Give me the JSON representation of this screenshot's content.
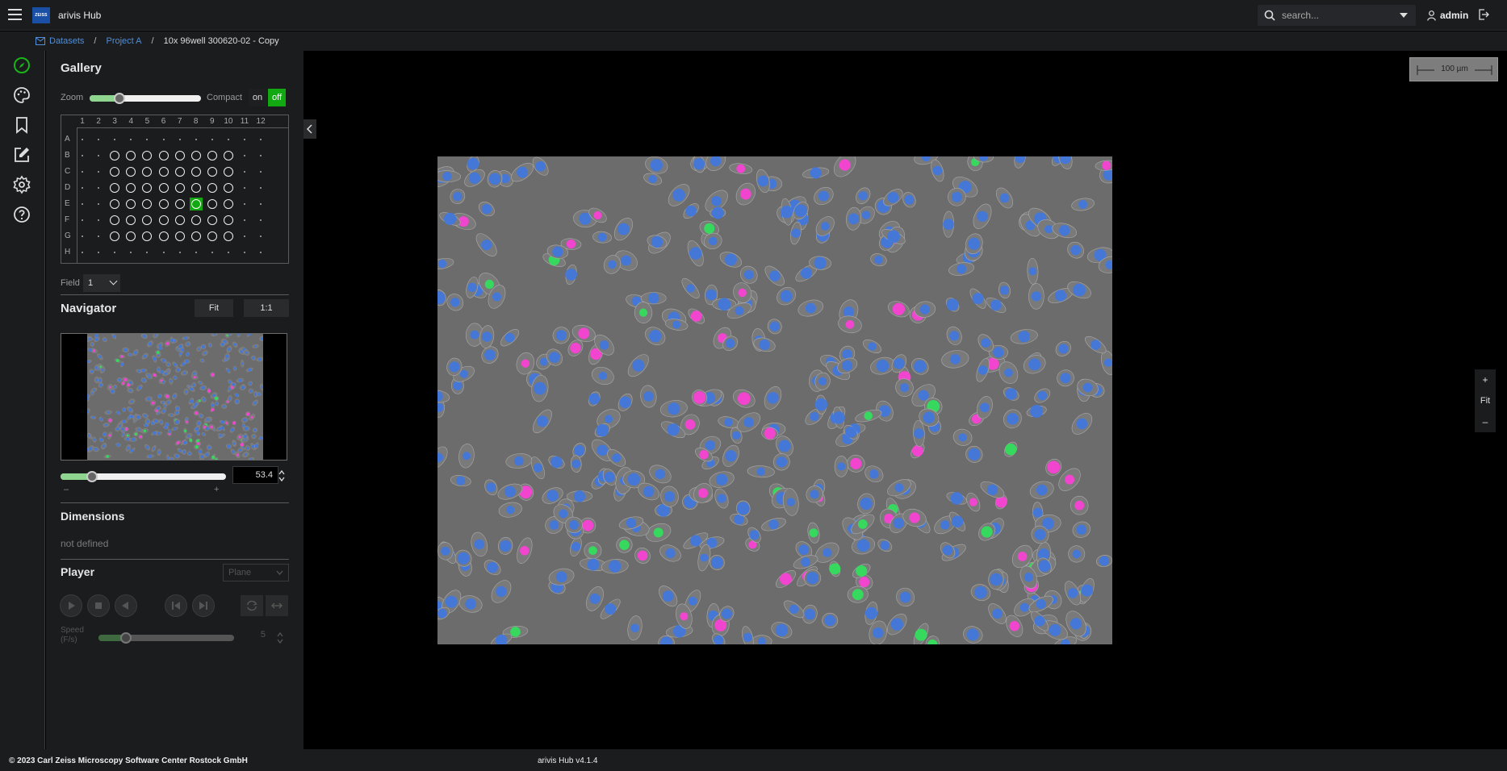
{
  "header": {
    "logo_text": "ZEISS",
    "app_title": "arivis Hub",
    "search_placeholder": "search...",
    "user_name": "admin"
  },
  "breadcrumb": {
    "items": [
      "Datasets",
      "Project A"
    ],
    "current": "10x 96well 300620-02 - Copy"
  },
  "gallery": {
    "title": "Gallery",
    "zoom_label": "Zoom",
    "zoom_fraction": 0.27,
    "compact_label": "Compact",
    "compact_on": "on",
    "compact_off": "off",
    "compact_state": "off",
    "columns": [
      "1",
      "2",
      "3",
      "4",
      "5",
      "6",
      "7",
      "8",
      "9",
      "10",
      "11",
      "12"
    ],
    "rows": [
      "A",
      "B",
      "C",
      "D",
      "E",
      "F",
      "G",
      "H"
    ],
    "selected_well": "E8",
    "field_label": "Field",
    "field_value": "1"
  },
  "navigator": {
    "title": "Navigator",
    "fit_label": "Fit",
    "one_to_one_label": "1:1",
    "zoom_value": "53.4",
    "zoom_fraction": 0.19,
    "minus": "–",
    "plus": "+"
  },
  "dimensions": {
    "title": "Dimensions",
    "value": "not defined"
  },
  "player": {
    "title": "Player",
    "mode": "Plane",
    "speed_label": "Speed",
    "speed_unit": "(F/s)",
    "speed_value": "5",
    "speed_fraction": 0.2
  },
  "viewer": {
    "scalebar": "100 µm",
    "zoom_in": "+",
    "fit": "Fit",
    "zoom_out": "–"
  },
  "footer": {
    "copyright": "© 2023 Carl Zeiss Microscopy Software Center Rostock GmbH",
    "version": "arivis Hub v4.1.4"
  },
  "colors": {
    "accent_green": "#11a811",
    "link_blue": "#4f8fdb",
    "panel_bg": "#1b1c1e",
    "nucleus_blue": "#3f78e0",
    "nucleus_magenta": "#ff3fd8",
    "cell_green": "#2fe25a"
  }
}
